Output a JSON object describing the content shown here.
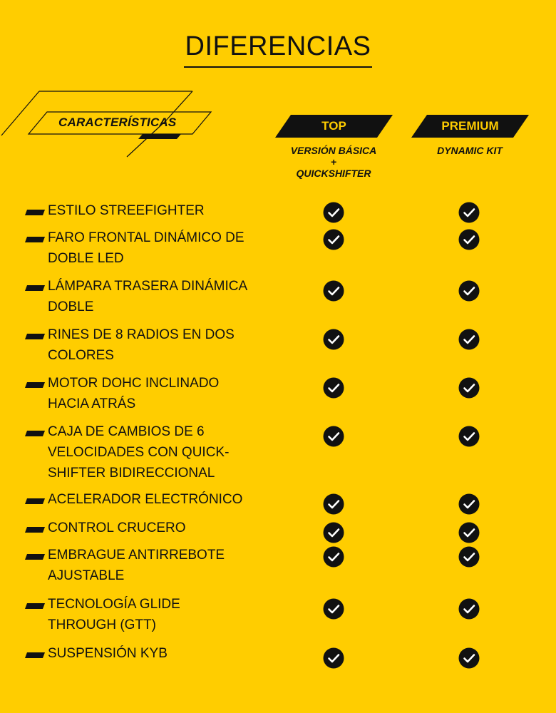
{
  "title": "DIFERENCIAS",
  "features_header": "CARACTERÍSTICAS",
  "plans": [
    {
      "name": "TOP",
      "subtitle_lines": [
        "VERSIÓN BÁSICA",
        "+",
        "QUICKSHIFTER"
      ]
    },
    {
      "name": "PREMIUM",
      "subtitle_lines": [
        "DYNAMIC KIT"
      ]
    }
  ],
  "features": [
    {
      "lines": [
        "ESTILO STREEFIGHTER"
      ],
      "top": true,
      "premium": true
    },
    {
      "lines": [
        "FARO FRONTAL DINÁMICO DE",
        "DOBLE LED"
      ],
      "top": true,
      "premium": true
    },
    {
      "lines": [
        "LÁMPARA TRASERA DINÁMICA",
        "DOBLE"
      ],
      "top": true,
      "premium": true
    },
    {
      "lines": [
        "RINES DE 8 RADIOS EN DOS",
        "COLORES"
      ],
      "top": true,
      "premium": true
    },
    {
      "lines": [
        "MOTOR DOHC INCLINADO",
        "HACIA ATRÁS"
      ],
      "top": true,
      "premium": true
    },
    {
      "lines": [
        "CAJA DE CAMBIOS DE 6",
        "VELOCIDADES CON QUICK-",
        "SHIFTER BIDIRECCIONAL"
      ],
      "top": true,
      "premium": true
    },
    {
      "lines": [
        "ACELERADOR ELECTRÓNICO"
      ],
      "top": true,
      "premium": true
    },
    {
      "lines": [
        "CONTROL CRUCERO"
      ],
      "top": true,
      "premium": true
    },
    {
      "lines": [
        "EMBRAGUE ANTIRREBOTE",
        "AJUSTABLE"
      ],
      "top": true,
      "premium": true
    },
    {
      "lines": [
        "TECNOLOGÍA GLIDE",
        "THROUGH (GTT)"
      ],
      "top": true,
      "premium": true
    },
    {
      "lines": [
        "SUSPENSIÓN KYB"
      ],
      "top": true,
      "premium": true
    }
  ],
  "colors": {
    "background": "#FFCD00",
    "ink": "#111111",
    "badge_text": "#FFCD00"
  },
  "icons": {
    "check": "check-circle-icon",
    "bullet": "dash-bullet-icon"
  }
}
